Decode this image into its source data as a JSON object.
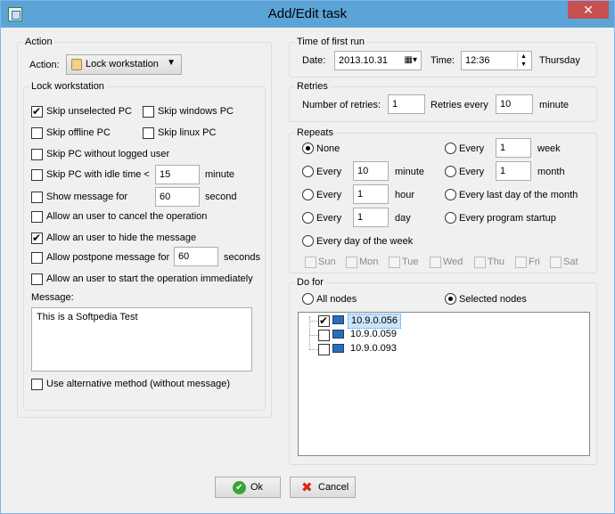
{
  "window": {
    "title": "Add/Edit task"
  },
  "action_group": {
    "label": "Action",
    "action_label": "Action:",
    "action_value": "Lock workstation"
  },
  "lock_group": {
    "label": "Lock workstation",
    "skip_unselected": "Skip unselected PC",
    "skip_windows": "Skip windows PC",
    "skip_offline": "Skip offline PC",
    "skip_linux": "Skip linux PC",
    "skip_no_user": "Skip PC without logged user",
    "skip_idle": "Skip PC with idle time <",
    "idle_value": "15",
    "idle_unit": "minute",
    "show_message": "Show message for",
    "show_value": "60",
    "show_unit": "second",
    "allow_cancel": "Allow an user to cancel the operation",
    "allow_hide": "Allow an user to hide the message",
    "allow_postpone": "Allow postpone message for",
    "postpone_value": "60",
    "postpone_unit": "seconds",
    "allow_start": "Allow an user to start the operation immediately",
    "message_label": "Message:",
    "message_text": "This is a Softpedia Test",
    "alt_method": "Use alternative method (without message)"
  },
  "first_run": {
    "label": "Time of first run",
    "date_label": "Date:",
    "date_value": "2013.10.31",
    "time_label": "Time:",
    "time_value": "12:36",
    "weekday": "Thursday"
  },
  "retries": {
    "label": "Retries",
    "number_label": "Number of retries:",
    "number_value": "1",
    "every_label": "Retries every",
    "every_value": "10",
    "unit": "minute"
  },
  "repeats": {
    "label": "Repeats",
    "none": "None",
    "every": "Every",
    "minute_value": "10",
    "minute_unit": "minute",
    "hour_value": "1",
    "hour_unit": "hour",
    "day_value": "1",
    "day_unit": "day",
    "week_value": "1",
    "week_unit": "week",
    "month_value": "1",
    "month_unit": "month",
    "last_day": "Every last day of the month",
    "program_startup": "Every program startup",
    "weekday_option": "Every day of the week",
    "days": [
      "Sun",
      "Mon",
      "Tue",
      "Wed",
      "Thu",
      "Fri",
      "Sat"
    ]
  },
  "do_for": {
    "label": "Do for",
    "all_nodes": "All nodes",
    "selected_nodes": "Selected nodes",
    "nodes": [
      "10.9.0.056",
      "10.9.0.059",
      "10.9.0.093"
    ]
  },
  "buttons": {
    "ok": "Ok",
    "cancel": "Cancel"
  },
  "colors": {
    "titlebar": "#5ba4d8",
    "close": "#c75050",
    "selection": "#3399ff"
  }
}
